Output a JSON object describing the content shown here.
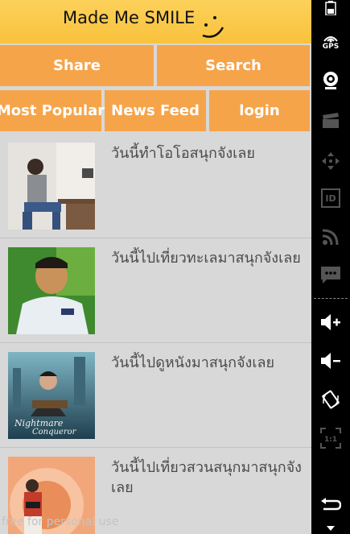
{
  "app": {
    "title": "Made Me SMILE",
    "accent_color": "#f6a44a",
    "header_color": "#f9c23c"
  },
  "nav_buttons": {
    "share": "Share",
    "search": "Search",
    "most_popular": "Most Popular",
    "news_feed": "News Feed",
    "login": "login"
  },
  "feed": [
    {
      "text": "วันนี้ทำโอโอสนุกจังเลย",
      "thumb": "photo-person-seated-room"
    },
    {
      "text": "วันนี้ไปเที่ยวทะเลมาสนุกจังเลย",
      "thumb": "photo-person-smiling"
    },
    {
      "text": "วันนี้ไปดูหนังมาสนุกจังเลย",
      "thumb": "photo-movie-poster"
    },
    {
      "text": "วันนี้ไปเที่ยวสวนสนุกมาสนุกจังเลย",
      "thumb": "photo-person-orange-background"
    }
  ],
  "poster_text": {
    "line1": "Nightmare",
    "line2": "Conqueror"
  },
  "watermark": "free for personal use",
  "emulator_bar": {
    "gps_label": "GPS",
    "id_label": "ID",
    "scale_label": "1:1",
    "icons": [
      "battery-icon",
      "gps-icon",
      "camera-icon",
      "clapper-icon",
      "dpad-icon",
      "id-icon",
      "rss-icon",
      "sms-icon",
      "volume-up-icon",
      "volume-down-icon",
      "rotate-icon",
      "scale-icon",
      "back-icon"
    ]
  }
}
